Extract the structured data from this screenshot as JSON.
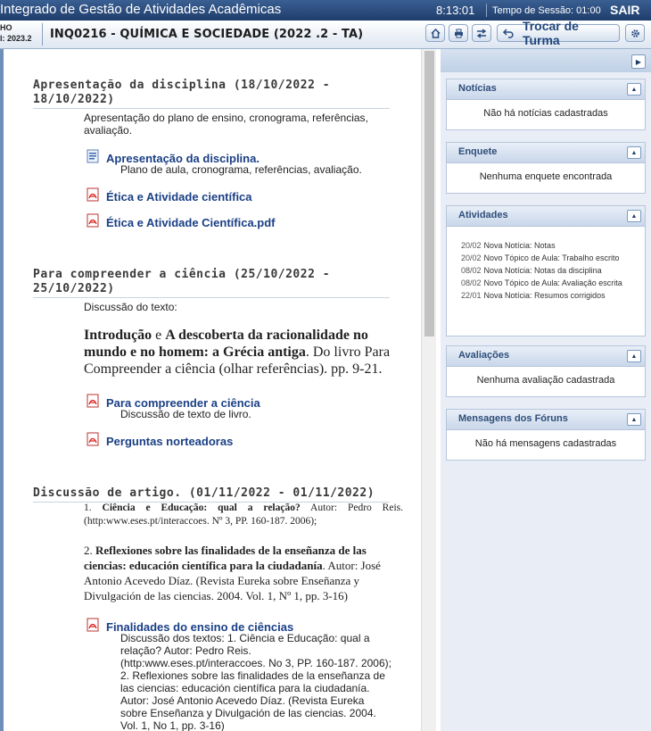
{
  "header": {
    "system_title": "Integrado de Gestão de Atividades Acadêmicas",
    "clock": "8:13:01",
    "session": "Tempo de Sessão: 01:00",
    "exit": "SAIR"
  },
  "coursebar": {
    "context_line1": "HO",
    "context_line2": "l: 2023.2",
    "course_title": "INQ0216 - QUÍMICA E SOCIEDADE (2022 .2 - TA)",
    "change_class": "Trocar de Turma"
  },
  "topics": [
    {
      "title": "Apresentação da disciplina (18/10/2022 - 18/10/2022)",
      "description": "Apresentação do plano de ensino, cronograma, referências, avaliação.",
      "resources": [
        {
          "icon": "document-icon",
          "label": "Apresentação da disciplina.",
          "sub": "Plano de aula, cronograma, referências, avaliação."
        },
        {
          "icon": "pdf-icon",
          "label": "Ética e Atividade científica"
        },
        {
          "icon": "pdf-icon",
          "label": "Ética e Atividade Científica.pdf"
        }
      ]
    },
    {
      "title": "Para compreender a ciência (25/10/2022 - 25/10/2022)",
      "description": "Discussão do texto:",
      "reading_bold1": "Introdução",
      "reading_e": " e ",
      "reading_bold2": "A descoberta da racionalidade no mundo e no homem: a Grécia antiga",
      "reading_rest": ". Do livro Para Compreender a ciência (olhar referências). pp. 9-21.",
      "resources": [
        {
          "icon": "pdf-icon",
          "label": "Para compreender a ciência",
          "sub": "Discussão de texto de livro."
        },
        {
          "icon": "pdf-icon",
          "label": "Perguntas norteadoras"
        }
      ]
    },
    {
      "title": "Discussão de artigo. (01/11/2022 - 01/11/2022)",
      "item1_num": "1. ",
      "item1_bold": "Ciência e Educação: qual a relação?",
      "item1_rest": " Autor: Pedro Reis. (http:www.eses.pt/interaccoes. Nº 3, PP. 160-187. 2006);",
      "item2_num": "2. ",
      "item2_bold": "Reflexiones sobre las finalidades de la enseñanza de las ciencias: educación científica para la ciudadanía",
      "item2_rest": ". Autor: José Antonio Acevedo Díaz. (Revista Eureka sobre Enseñanza y Divulgación de las ciencias. 2004. Vol. 1, Nº 1, pp. 3-16)",
      "resources": [
        {
          "icon": "pdf-icon",
          "label": "Finalidades do ensino de ciências",
          "sub": "Discussão dos textos: 1. Ciência e Educação: qual a relação? Autor: Pedro Reis. (http:www.eses.pt/interaccoes. No 3, PP. 160-187. 2006); 2. Reflexiones sobre las finalidades de la enseñanza de las ciencias: educación científica para la ciudadanía. Autor: José Antonio Acevedo Díaz. (Revista Eureka sobre Enseñanza y Divulgación de las ciencias. 2004. Vol. 1, No 1, pp. 3-16)"
        }
      ]
    }
  ],
  "sidebar": {
    "noticias": {
      "title": "Notícias",
      "empty": "Não há notícias cadastradas"
    },
    "enquete": {
      "title": "Enquete",
      "empty": "Nenhuma enquete encontrada"
    },
    "atividades": {
      "title": "Atividades",
      "items": [
        {
          "date": "20/02",
          "text": "Nova Notícia: Notas"
        },
        {
          "date": "20/02",
          "text": "Novo Tópico de Aula: Trabalho escrito"
        },
        {
          "date": "08/02",
          "text": "Nova Notícia: Notas da disciplina"
        },
        {
          "date": "08/02",
          "text": "Novo Tópico de Aula: Avaliação escrita"
        },
        {
          "date": "22/01",
          "text": "Nova Notícia: Resumos corrigidos"
        }
      ]
    },
    "avaliacoes": {
      "title": "Avaliações",
      "empty": "Nenhuma avaliação cadastrada"
    },
    "foruns": {
      "title": "Mensagens dos Fóruns",
      "empty": "Não há mensagens cadastradas"
    }
  }
}
